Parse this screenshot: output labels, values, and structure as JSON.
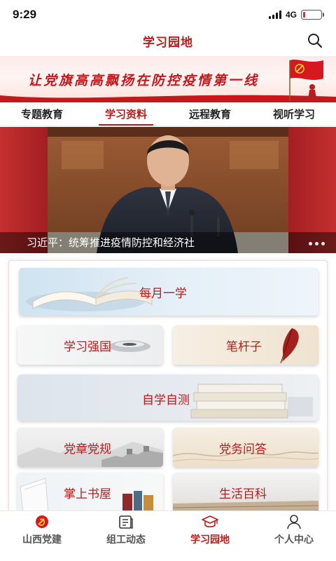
{
  "status_bar": {
    "time": "9:29",
    "network": "4G",
    "battery_level": 0.12
  },
  "header": {
    "title": "学习园地"
  },
  "banner": {
    "text": "让党旗高高飘扬在防控疫情第一线"
  },
  "tabs": [
    {
      "label": "专题教育",
      "active": false
    },
    {
      "label": "学习资料",
      "active": true
    },
    {
      "label": "远程教育",
      "active": false
    },
    {
      "label": "视听学习",
      "active": false
    }
  ],
  "carousel": {
    "caption": "习近平：统筹推进疫情防控和经济社"
  },
  "cards": {
    "monthly": "每月一学",
    "qiangguo": "学习强国",
    "bigan": "笔杆子",
    "self_test": "自学自测",
    "constitution": "党章党规",
    "qa": "党务问答",
    "bookstore": "掌上书屋",
    "encyclopedia": "生活百科"
  },
  "bottom_nav": [
    {
      "label": "山西党建",
      "icon": "party-emblem-icon",
      "active": false
    },
    {
      "label": "组工动态",
      "icon": "news-icon",
      "active": false
    },
    {
      "label": "学习园地",
      "icon": "graduation-cap-icon",
      "active": true
    },
    {
      "label": "个人中心",
      "icon": "person-icon",
      "active": false
    }
  ],
  "colors": {
    "accent": "#b81c1c",
    "banner_red": "#c8161d"
  }
}
